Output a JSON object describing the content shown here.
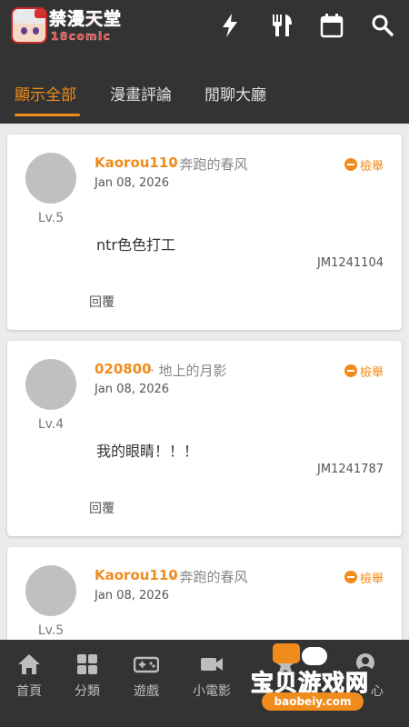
{
  "header": {
    "logo_title": "禁漫天堂",
    "logo_sub": "18comic",
    "icons": [
      "flash-icon",
      "utensils-icon",
      "calendar-icon",
      "search-icon"
    ]
  },
  "tabs": [
    {
      "label": "顯示全部",
      "active": true
    },
    {
      "label": "漫畫評論",
      "active": false
    },
    {
      "label": "閒聊大廳",
      "active": false
    }
  ],
  "comments": [
    {
      "username": "Kaorou110",
      "subtitle": "· 奔跑的春风",
      "date": "Jan 08, 2026",
      "level": "Lv.5",
      "report": "檢舉",
      "content": "ntr色色打工",
      "jm_id": "JM1241104",
      "reply": "回覆"
    },
    {
      "username": "020800",
      "subtitle": "· 地上的月影",
      "date": "Jan 08, 2026",
      "level": "Lv.4",
      "report": "檢舉",
      "content": "我的眼睛！！！",
      "jm_id": "JM1241787",
      "reply": "回覆"
    },
    {
      "username": "Kaorou110",
      "subtitle": "· 奔跑的春风",
      "date": "Jan 08, 2026",
      "level": "Lv.5",
      "report": "檢舉",
      "content": "",
      "jm_id": "",
      "reply": ""
    }
  ],
  "bottom_nav": [
    {
      "label": "首頁",
      "icon": "home-icon"
    },
    {
      "label": "分類",
      "icon": "grid-icon"
    },
    {
      "label": "遊戲",
      "icon": "gamepad-icon"
    },
    {
      "label": "小電影",
      "icon": "video-icon"
    },
    {
      "label": "",
      "icon": "star-icon"
    },
    {
      "label": "心",
      "icon": "user-icon"
    }
  ],
  "watermark": {
    "text": "宝贝游戏网",
    "url": "baobeiy.com"
  },
  "colors": {
    "accent": "#f08c1c",
    "bar": "#333333",
    "background": "#ebebeb"
  }
}
